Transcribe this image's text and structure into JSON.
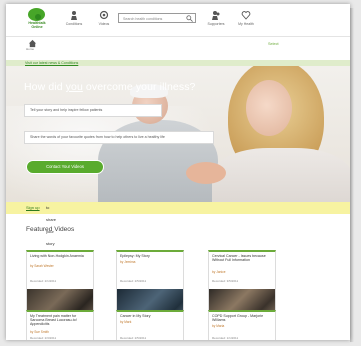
{
  "header": {
    "logo_text": "Healthtalk\nOnline",
    "nav": [
      {
        "label": "Conditions",
        "icon": "person-icon"
      },
      {
        "label": "Videos",
        "icon": "camera-icon"
      }
    ],
    "search_placeholder": "Search health conditions",
    "right_nav": [
      {
        "label": "Supporters",
        "icon": "people-icon"
      },
      {
        "label": "My Health",
        "icon": "heart-icon"
      }
    ]
  },
  "subbar": {
    "home_label": "Home",
    "link": "Select"
  },
  "announcement": "Visit our latest news & Conditions",
  "hero": {
    "title_pre": "How did ",
    "title_underlined": "you",
    "title_post": " overcome your illness?",
    "box1": "Tell your story and help inspire fellow patients",
    "box2": "Share the words of your favourite quotes from how to help others to live a healthy life",
    "button": "Contact Your Videos"
  },
  "yellowbar": {
    "link": "Sign up",
    "text": " to share your story and inspire fellow patients"
  },
  "featured": {
    "title": "Featured Videos",
    "cards": [
      {
        "title": "Living with Non-Hodgkin Anaemia",
        "by": "by Sarah Wester",
        "meta": "Recorded: 2/1/2011"
      },
      {
        "title": "Epilepsy: My Story",
        "by": "by Jemima",
        "meta": "Recorded: 2/5/2011"
      },
      {
        "title": "Cervical Cancer - Issues because Without Full Information",
        "by": "by Janice",
        "meta": "Recorded: 3/5/2011"
      },
      {
        "title": "My Treatment pain matter for Sarcoma Breast Lucorasu-to! Appendicitis",
        "by": "by Sue Smith",
        "meta": "Recorded: 2/3/2011"
      },
      {
        "title": "Cancer in My Story",
        "by": "by Mark",
        "meta": "Recorded: 2/5/2011"
      },
      {
        "title": "COPD Support Group - Marjorie Williams",
        "by": "by Maria",
        "meta": "Recorded: 1/1/2011"
      }
    ]
  },
  "colors": {
    "brand_green": "#59ab2d",
    "banner_yellow": "#f7f3a1",
    "announce_green": "#dfeccb"
  }
}
